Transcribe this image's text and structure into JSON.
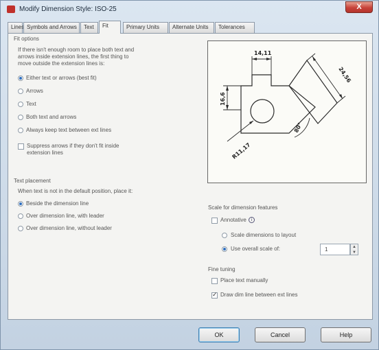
{
  "window": {
    "title": "Modify Dimension Style: ISO-25",
    "close_label": "X"
  },
  "tabs": [
    "Lines",
    "Symbols and Arrows",
    "Text",
    "Fit",
    "Primary Units",
    "Alternate Units",
    "Tolerances"
  ],
  "fit_options": {
    "heading": "Fit options",
    "description": [
      "If there isn't enough room to place both text and",
      "arrows inside extension lines, the first thing to",
      "move outside the extension lines is:"
    ],
    "radios": [
      "Either text or arrows (best fit)",
      "Arrows",
      "Text",
      "Both text and arrows",
      "Always keep text between ext lines"
    ],
    "suppress_label": [
      "Suppress arrows if they don't fit inside",
      "extension lines"
    ]
  },
  "text_placement": {
    "heading": "Text placement",
    "description": "When text is not in the default position, place it:",
    "radios": [
      "Beside the dimension line",
      "Over dimension line, with leader",
      "Over dimension line, without leader"
    ]
  },
  "preview": {
    "dim_top": "14,11",
    "dim_left": "16,6",
    "dim_right": "24,56",
    "dim_angle": "80°",
    "dim_radius": "R11,17"
  },
  "scale": {
    "heading": "Scale for dimension features",
    "annotative_label": "Annotative",
    "info_icon": "i",
    "layout_label": "Scale dimensions to layout",
    "overall_label": "Use overall scale of:",
    "overall_value": "1",
    "spin_up": "▲",
    "spin_down": "▼"
  },
  "fine_tuning": {
    "heading": "Fine tuning",
    "manual_label": "Place text manually",
    "draw_label": "Draw dim line between ext lines"
  },
  "buttons": {
    "ok": "OK",
    "cancel": "Cancel",
    "help": "Help"
  }
}
